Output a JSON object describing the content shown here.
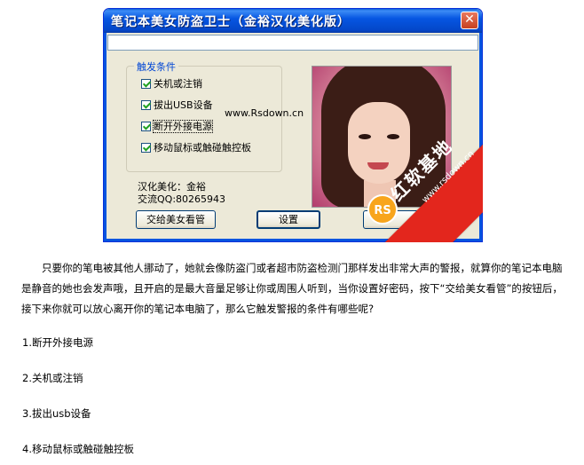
{
  "window": {
    "title": "笔记本美女防盗卫士（金裕汉化美化版）",
    "close_glyph": "✕",
    "input_value": ""
  },
  "group": {
    "legend": "触发条件",
    "options": [
      {
        "label": "关机或注销",
        "checked": true
      },
      {
        "label": "拔出USB设备",
        "checked": true
      },
      {
        "label": "断开外接电源",
        "checked": true
      },
      {
        "label": "移动鼠标或触碰触控板",
        "checked": true
      }
    ]
  },
  "watermark_url": "www.Rsdown.cn",
  "credits": {
    "line1": "汉化美化：金裕",
    "line2": "交流QQ:80265943"
  },
  "buttons": {
    "hand_over": "交给美女看管",
    "settings": "设置"
  },
  "ribbon": {
    "logo": "RS",
    "brand": "红软基地",
    "site": "www.rsdown.cn",
    "color": "#e3261d"
  },
  "article": {
    "paragraph": "只要你的笔电被其他人挪动了，她就会像防盗门或者超市防盗检测门那样发出非常大声的警报，就算你的笔记本电脑是静音的她也会发声哦，且开启的是最大音量足够让你或周围人听到，当你设置好密码，按下“交给美女看管”的按钮后，接下来你就可以放心离开你的笔记本电脑了，那么它触发警报的条件有哪些呢?",
    "list": [
      "1.断开外接电源",
      "2.关机或注销",
      "3.拔出usb设备",
      "4.移动鼠标或触碰触控板"
    ]
  }
}
